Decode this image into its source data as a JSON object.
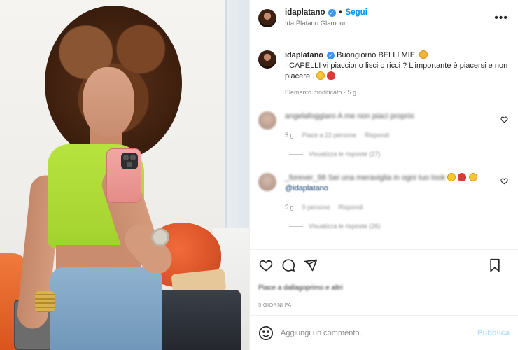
{
  "header": {
    "username": "idaplatano",
    "follow_label": "Segui",
    "dot": "•",
    "subtitle": "Ida Platano Glamour",
    "more": "•••"
  },
  "caption": {
    "username": "idaplatano",
    "line1": "Buongiorno BELLI MIEI",
    "line2": "I CAPELLI vi piacciono lisci o ricci ? L'importante è piacersi e non piacere .",
    "meta": "Elemento modificato · 5 g"
  },
  "comments": [
    {
      "username": "angelafoggiaro",
      "text": "A me non piaci proprio",
      "time": "5 g",
      "likes": "Piace a 22 persone",
      "reply": "Rispondi",
      "replies_label": "Visualizza le risposte (27)"
    },
    {
      "username": "_forever_98",
      "text": "Sei una meraviglia in ogni tuo look",
      "mention": "@idaplatano",
      "time": "5 g",
      "likes": "9 persone",
      "reply": "Rispondi",
      "replies_label": "Visualizza le risposte (26)"
    }
  ],
  "likes_text": "Piace a dallagoprimo e altri",
  "time_ago": "5 GIORNI FA",
  "add_comment": {
    "placeholder": "Aggiungi un commento...",
    "publish_label": "Pubblica"
  },
  "colors": {
    "accent": "#0095f6",
    "publish_disabled": "#b2dffc",
    "verified": "#3897f0"
  }
}
